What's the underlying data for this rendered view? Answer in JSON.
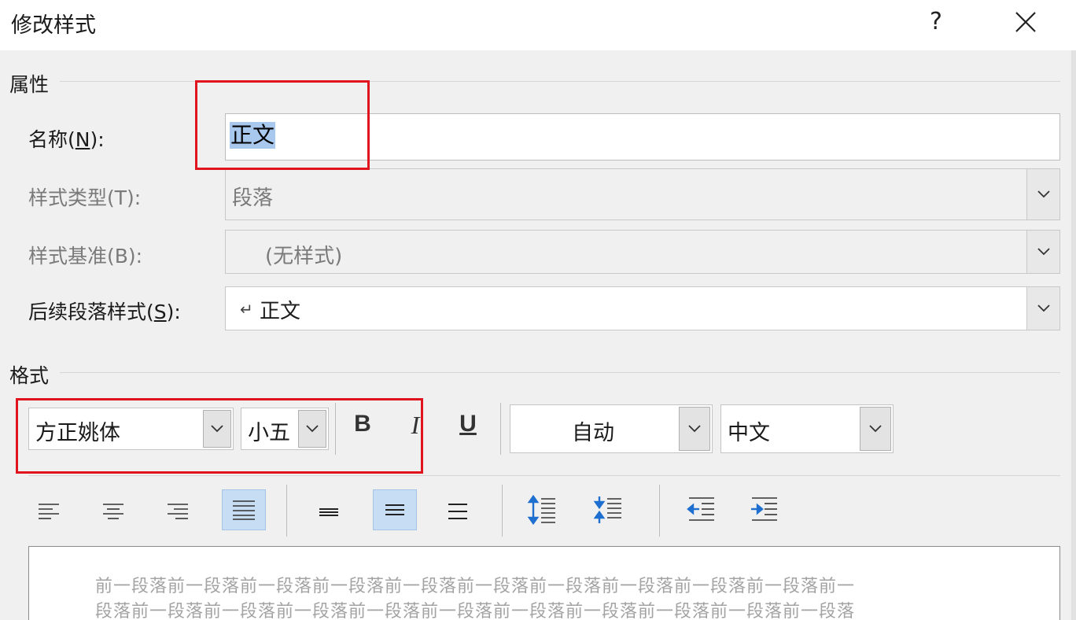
{
  "dialog": {
    "title": "修改样式",
    "help_label": "?",
    "close_icon": "close-icon"
  },
  "properties": {
    "section_label": "属性",
    "name": {
      "label": "名称(",
      "mnemonic": "N",
      "suffix": "):",
      "value": "正文"
    },
    "style_type": {
      "label": "样式类型(T):",
      "value": "段落"
    },
    "style_based_on": {
      "label": "样式基准(B):",
      "value": "(无样式)"
    },
    "next_style": {
      "label": "后续段落样式(",
      "mnemonic": "S",
      "suffix": "):",
      "value": "正文",
      "symbol": "↵"
    }
  },
  "format": {
    "section_label": "格式",
    "font": "方正姚体",
    "size": "小五",
    "bold_label": "B",
    "italic_label": "I",
    "underline_label": "U",
    "color": "自动",
    "script": "中文"
  },
  "toolbar_icons": [
    "align-left-icon",
    "align-center-icon",
    "align-right-icon",
    "justify-icon",
    "single-spacing-icon",
    "one-half-spacing-icon",
    "double-spacing-icon",
    "increase-paragraph-spacing-icon",
    "decrease-paragraph-spacing-icon",
    "decrease-indent-icon",
    "increase-indent-icon"
  ],
  "preview": {
    "line1": "前一段落前一段落前一段落前一段落前一段落前一段落前一段落前一段落前一段落前一段落前一",
    "line2": "段落前一段落前一段落前一段落前一段落前一段落前一段落前一段落前一段落前一段落前一段落"
  },
  "colors": {
    "highlight_red": "#e0141e",
    "selection_blue": "#a8c8ee",
    "active_button": "#c7ddf4",
    "icon_blue": "#1f6fd0"
  }
}
